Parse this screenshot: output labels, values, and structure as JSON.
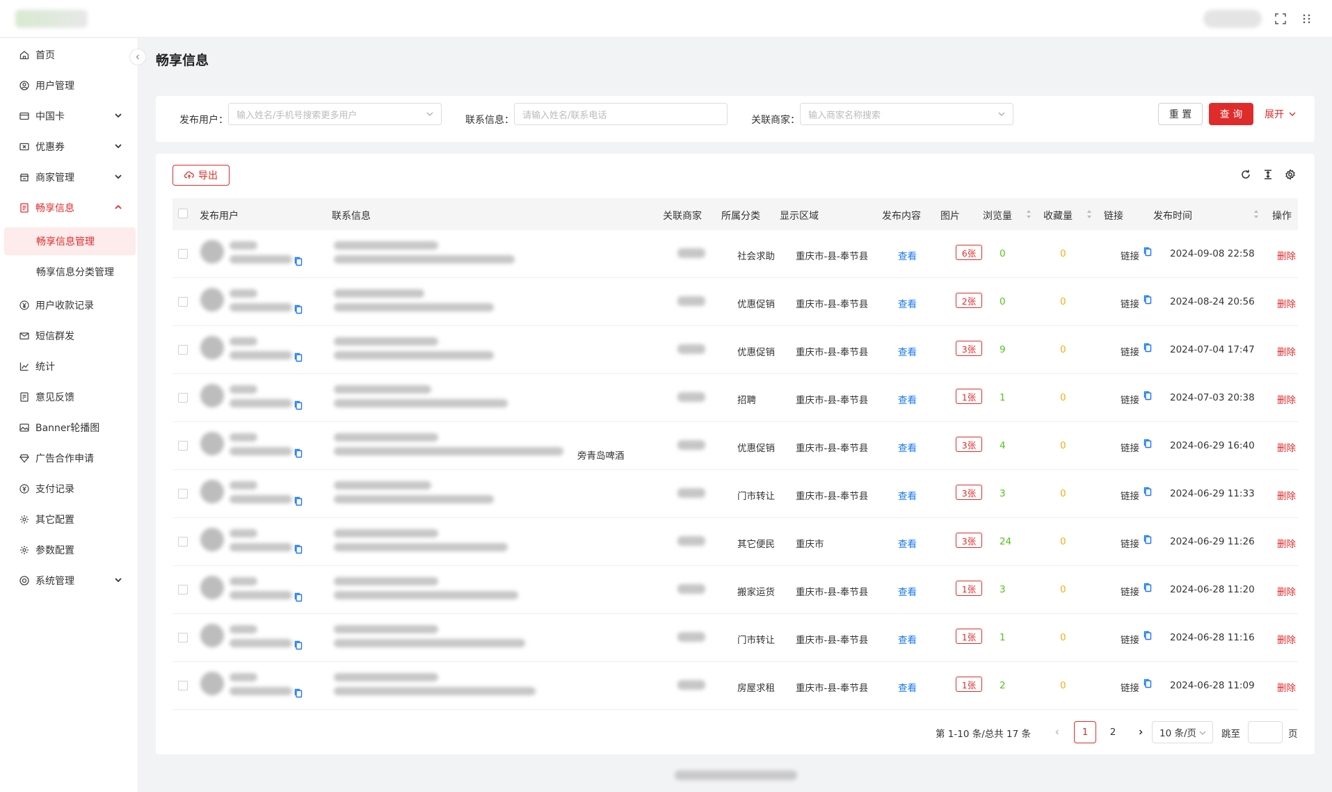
{
  "header": {
    "icons": [
      "fullscreen-icon",
      "grid-dots-icon"
    ]
  },
  "sidebar": {
    "items": [
      {
        "label": "首页",
        "icon": "home-icon"
      },
      {
        "label": "用户管理",
        "icon": "user-circle-icon"
      },
      {
        "label": "中国卡",
        "icon": "card-icon"
      },
      {
        "label": "优惠券",
        "icon": "coupon-icon"
      },
      {
        "label": "商家管理",
        "icon": "store-icon"
      },
      {
        "label": "畅享信息",
        "icon": "document-icon"
      },
      {
        "label": "畅享信息管理"
      },
      {
        "label": "畅享信息分类管理"
      },
      {
        "label": "用户收款记录",
        "icon": "yen-circle-icon"
      },
      {
        "label": "短信群发",
        "icon": "mail-icon"
      },
      {
        "label": "统计",
        "icon": "chart-icon"
      },
      {
        "label": "意见反馈",
        "icon": "feedback-icon"
      },
      {
        "label": "Banner轮播图",
        "icon": "image-icon"
      },
      {
        "label": "广告合作申请",
        "icon": "diamond-icon"
      },
      {
        "label": "支付记录",
        "icon": "pay-circle-icon"
      },
      {
        "label": "其它配置",
        "icon": "gear-icon"
      },
      {
        "label": "参数配置",
        "icon": "gear-icon"
      },
      {
        "label": "系统管理",
        "icon": "system-icon"
      }
    ]
  },
  "page": {
    "title": "畅享信息"
  },
  "search": {
    "user_label": "发布用户：",
    "user_placeholder": "输入姓名/手机号搜索更多用户",
    "contact_label": "联系信息：",
    "contact_placeholder": "请输入姓名/联系电话",
    "merchant_label": "关联商家：",
    "merchant_placeholder": "输入商家名称搜索",
    "reset": "重 置",
    "query": "查 询",
    "expand": "展开"
  },
  "toolbar": {
    "export": "导出"
  },
  "table": {
    "columns": [
      "发布用户",
      "联系信息",
      "关联商家",
      "所属分类",
      "显示区域",
      "发布内容",
      "图片",
      "浏览量",
      "收藏量",
      "链接",
      "发布时间",
      "操作"
    ],
    "rows": [
      {
        "category": "社会求助",
        "region": "重庆市-县-奉节县",
        "content": "查看",
        "pics": "6张",
        "views": "0",
        "favs": "0",
        "link": "链接",
        "time": "2024-09-08 22:58",
        "action": "删除",
        "extra": ""
      },
      {
        "category": "优惠促销",
        "region": "重庆市-县-奉节县",
        "content": "查看",
        "pics": "2张",
        "views": "0",
        "favs": "0",
        "link": "链接",
        "time": "2024-08-24 20:56",
        "action": "删除",
        "extra": ""
      },
      {
        "category": "优惠促销",
        "region": "重庆市-县-奉节县",
        "content": "查看",
        "pics": "3张",
        "views": "9",
        "favs": "0",
        "link": "链接",
        "time": "2024-07-04 17:47",
        "action": "删除",
        "extra": ""
      },
      {
        "category": "招聘",
        "region": "重庆市-县-奉节县",
        "content": "查看",
        "pics": "1张",
        "views": "1",
        "favs": "0",
        "link": "链接",
        "time": "2024-07-03 20:38",
        "action": "删除",
        "extra": ""
      },
      {
        "category": "优惠促销",
        "region": "重庆市-县-奉节县",
        "content": "查看",
        "pics": "3张",
        "views": "4",
        "favs": "0",
        "link": "链接",
        "time": "2024-06-29 16:40",
        "action": "删除",
        "extra": "旁青岛啤酒"
      },
      {
        "category": "门市转让",
        "region": "重庆市-县-奉节县",
        "content": "查看",
        "pics": "3张",
        "views": "3",
        "favs": "0",
        "link": "链接",
        "time": "2024-06-29 11:33",
        "action": "删除",
        "extra": ""
      },
      {
        "category": "其它便民",
        "region": "重庆市",
        "content": "查看",
        "pics": "3张",
        "views": "24",
        "favs": "0",
        "link": "链接",
        "time": "2024-06-29 11:26",
        "action": "删除",
        "extra": ""
      },
      {
        "category": "搬家运货",
        "region": "重庆市-县-奉节县",
        "content": "查看",
        "pics": "1张",
        "views": "3",
        "favs": "0",
        "link": "链接",
        "time": "2024-06-28 11:20",
        "action": "删除",
        "extra": ""
      },
      {
        "category": "门市转让",
        "region": "重庆市-县-奉节县",
        "content": "查看",
        "pics": "1张",
        "views": "1",
        "favs": "0",
        "link": "链接",
        "time": "2024-06-28 11:16",
        "action": "删除",
        "extra": ""
      },
      {
        "category": "房屋求租",
        "region": "重庆市-县-奉节县",
        "content": "查看",
        "pics": "1张",
        "views": "2",
        "favs": "0",
        "link": "链接",
        "time": "2024-06-28 11:09",
        "action": "删除",
        "extra": ""
      }
    ]
  },
  "pagination": {
    "total_text": "第 1-10 条/总共 17 条",
    "pages": [
      "1",
      "2"
    ],
    "current": "1",
    "page_size": "10 条/页",
    "jump_label": "跳至",
    "page_suffix": "页"
  },
  "colors": {
    "accent": "#e02b2b",
    "link": "#1677ff",
    "views": "#52c41a",
    "favs": "#faad14"
  }
}
